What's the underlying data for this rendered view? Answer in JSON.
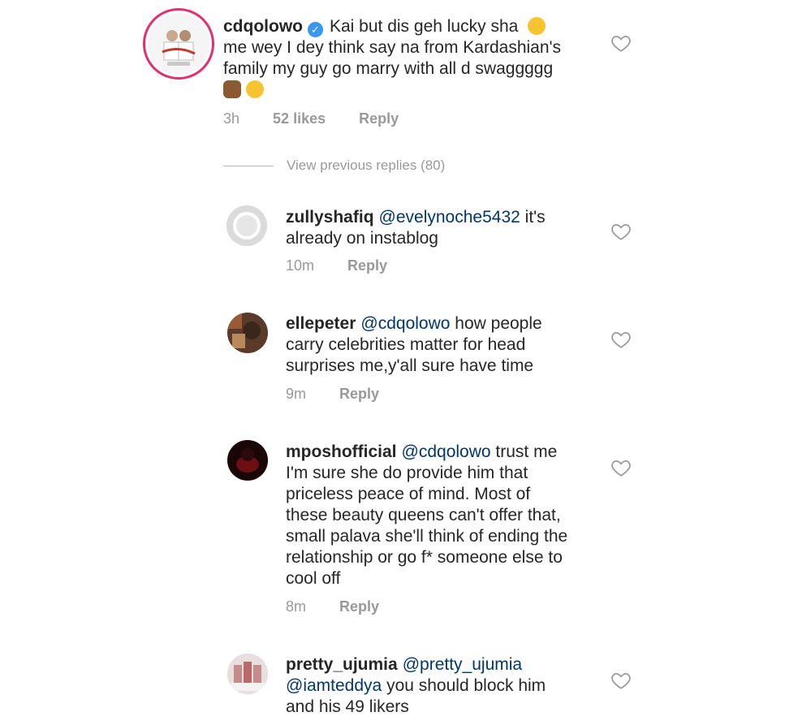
{
  "comments": [
    {
      "username": "cdqolowo",
      "text": "Kai but dis geh lucky sha",
      "line2": "me wey I dey think say na from Kardashian's",
      "line3": "family my guy go marry with all d swaggggg",
      "time": "3h",
      "likes": "52 likes",
      "reply": "Reply"
    },
    {
      "username": "zullyshafiq",
      "mention": "@evelynoche5432",
      "text": "it's",
      "line2": "already on instablog",
      "time": "10m",
      "reply": "Reply"
    },
    {
      "username": "ellepeter",
      "mention": "@cdqolowo",
      "text": "how people",
      "line2": "carry celebrities matter for head",
      "line3": "surprises me,y'all sure have time",
      "time": "9m",
      "reply": "Reply"
    },
    {
      "username": "mposhofficial",
      "mention": "@cdqolowo",
      "text": "trust me",
      "line2": "I'm sure she do provide him that",
      "line3": "priceless peace of mind. Most of",
      "line4": "these beauty queens can't offer that,",
      "line5": "small palava she'll think of ending the",
      "line6": "relationship or go f* someone else to",
      "line7": "cool off",
      "time": "8m",
      "reply": "Reply"
    },
    {
      "username": "pretty_ujumia",
      "mention": "@pretty_ujumia",
      "mention2": "@iamteddya",
      "text": "you should block him",
      "line2": "and his 49 likers"
    }
  ],
  "view_previous": "View previous replies (80)",
  "icons": {
    "heart": "heart-outline-icon",
    "verified": "verified-badge-icon"
  },
  "colors": {
    "mention": "#00376b",
    "verified": "#3897f0",
    "ring": "#e1306c",
    "meta": "#999999"
  }
}
